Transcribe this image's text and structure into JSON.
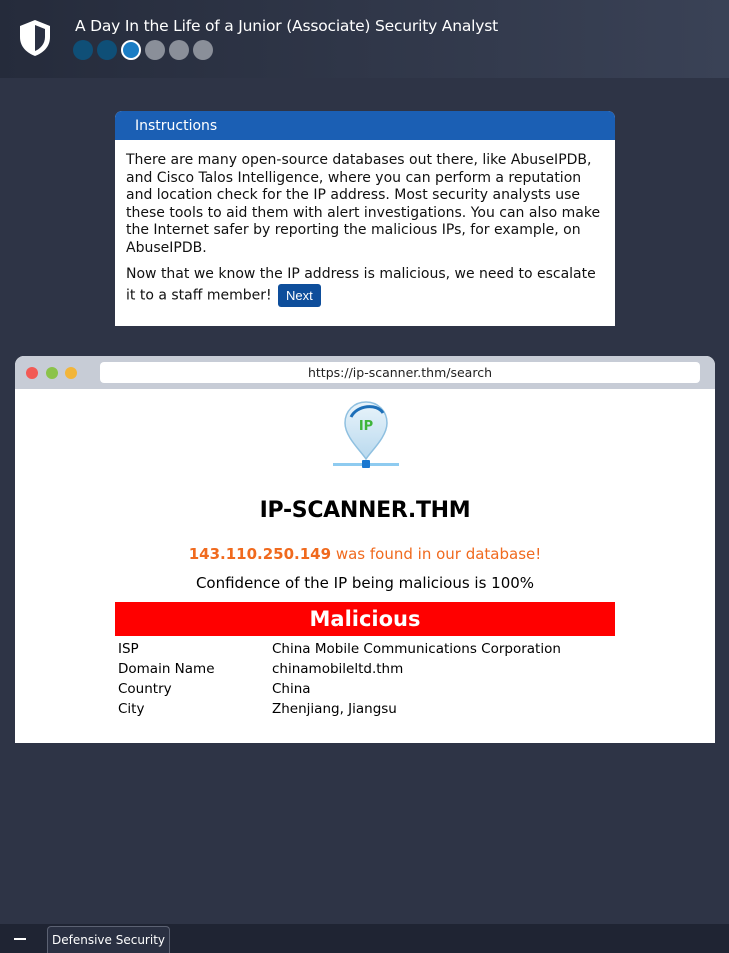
{
  "header": {
    "title": "A Day In the Life of a Junior (Associate) Security Analyst",
    "logo_icon": "shield-icon",
    "progress": {
      "total": 6,
      "completed": 2,
      "current": 3
    }
  },
  "instructions": {
    "heading": "Instructions",
    "paragraph1": "There are many open-source databases out there, like AbuseIPDB, and Cisco Talos Intelligence, where you can perform a reputation and location check for the IP address. Most security analysts use these tools to aid them with alert investigations. You can also make the Internet safer by reporting the malicious IPs, for example, on AbuseIPDB.",
    "paragraph2": "Now that we know the IP address is malicious, we need to escalate it to a staff member!",
    "next_label": "Next"
  },
  "browser": {
    "url": "https://ip-scanner.thm/search",
    "site_logo_text": "IP",
    "site_title": "IP-SCANNER.THM",
    "ip": "143.110.250.149",
    "found_text": "was found in our database!",
    "confidence_text": "Confidence of the IP being malicious is 100%",
    "verdict": "Malicious",
    "details": [
      {
        "label": "ISP",
        "value": "China Mobile Communications Corporation"
      },
      {
        "label": "Domain Name",
        "value": "chinamobileltd.thm"
      },
      {
        "label": "Country",
        "value": "China"
      },
      {
        "label": "City",
        "value": "Zhenjiang, Jiangsu"
      }
    ]
  },
  "taskbar": {
    "tab_label": "Defensive Security"
  },
  "colors": {
    "verdict_bg": "#ff0000",
    "found_text": "#f06a1e",
    "instructions_header": "#1b5fb4",
    "next_button": "#0e4e9b"
  }
}
